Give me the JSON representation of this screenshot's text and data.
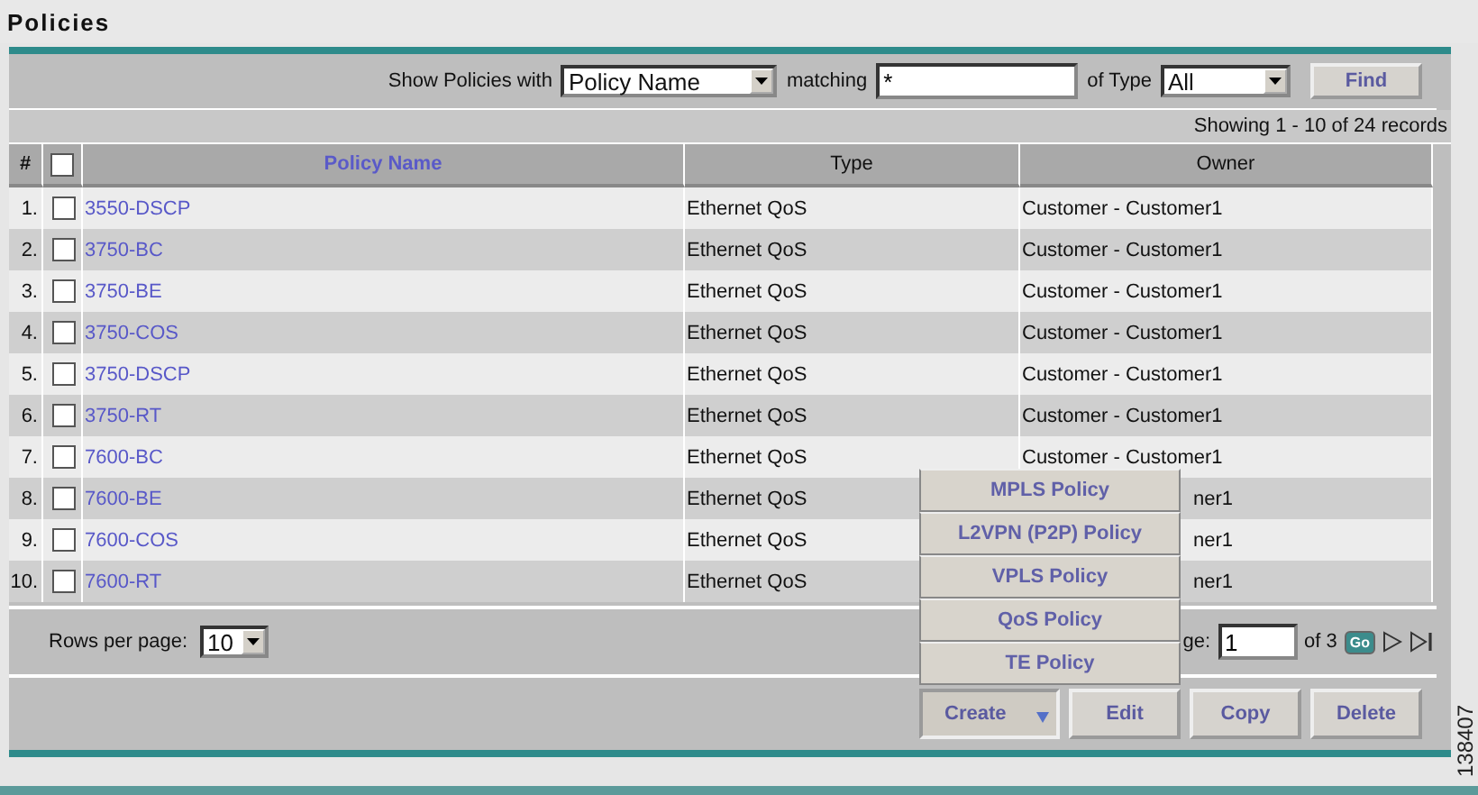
{
  "title": "Policies",
  "filter": {
    "label": "Show Policies with",
    "field_select": "Policy Name",
    "matching_label": "matching",
    "matching_value": "*",
    "type_label": "of Type",
    "type_select": "All",
    "find": "Find"
  },
  "showing": "Showing 1 - 10 of 24 records",
  "columns": {
    "number": "#",
    "select_all_checked": false,
    "name": "Policy Name",
    "type": "Type",
    "owner": "Owner"
  },
  "rows": [
    {
      "number": "1.",
      "checked": false,
      "name": "3550-DSCP",
      "type": "Ethernet QoS",
      "owner": "Customer - Customer1",
      "covered": false
    },
    {
      "number": "2.",
      "checked": false,
      "name": "3750-BC",
      "type": "Ethernet QoS",
      "owner": "Customer - Customer1",
      "covered": false
    },
    {
      "number": "3.",
      "checked": false,
      "name": "3750-BE",
      "type": "Ethernet QoS",
      "owner": "Customer - Customer1",
      "covered": false
    },
    {
      "number": "4.",
      "checked": false,
      "name": "3750-COS",
      "type": "Ethernet QoS",
      "owner": "Customer - Customer1",
      "covered": false
    },
    {
      "number": "5.",
      "checked": false,
      "name": "3750-DSCP",
      "type": "Ethernet QoS",
      "owner": "Customer - Customer1",
      "covered": false
    },
    {
      "number": "6.",
      "checked": false,
      "name": "3750-RT",
      "type": "Ethernet QoS",
      "owner": "Customer - Customer1",
      "covered": false
    },
    {
      "number": "7.",
      "checked": false,
      "name": "7600-BC",
      "type": "Ethernet QoS",
      "owner": "Customer - Customer1",
      "covered": false
    },
    {
      "number": "8.",
      "checked": false,
      "name": "7600-BE",
      "type": "Ethernet QoS",
      "owner": "ner1",
      "covered": true
    },
    {
      "number": "9.",
      "checked": false,
      "name": "7600-COS",
      "type": "Ethernet QoS",
      "owner": "ner1",
      "covered": true
    },
    {
      "number": "10.",
      "checked": false,
      "name": "7600-RT",
      "type": "Ethernet QoS",
      "owner": "ner1",
      "covered": true
    }
  ],
  "rows_per_page": {
    "label": "Rows per page:",
    "value": "10"
  },
  "pager": {
    "label": "ge:",
    "value": "1",
    "of": "of 3",
    "go": "Go"
  },
  "create": {
    "label": "Create",
    "expanded": true,
    "menu": [
      "MPLS Policy",
      "L2VPN (P2P) Policy",
      "VPLS Policy",
      "QoS Policy",
      "TE Policy"
    ]
  },
  "actions": [
    "Edit",
    "Copy",
    "Delete"
  ],
  "figure_id": "138407"
}
